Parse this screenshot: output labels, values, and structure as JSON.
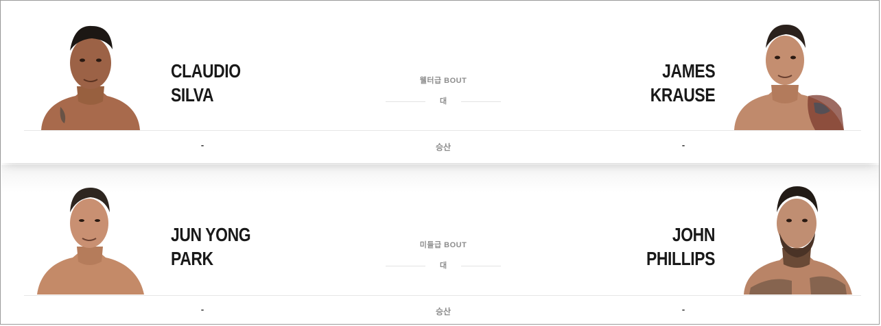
{
  "bouts": [
    {
      "red": {
        "first": "CLAUDIO",
        "last": "SILVA",
        "odds": "-"
      },
      "blue": {
        "first": "JAMES",
        "last": "KRAUSE",
        "odds": "-"
      },
      "weight_class": "웰터급 BOUT",
      "vs": "대",
      "result": "승산"
    },
    {
      "red": {
        "first": "JUN YONG",
        "last": "PARK",
        "odds": "-"
      },
      "blue": {
        "first": "JOHN",
        "last": "PHILLIPS",
        "odds": "-"
      },
      "weight_class": "미들급 BOUT",
      "vs": "대",
      "result": "승산"
    }
  ],
  "colors": {
    "name_text": "#191919",
    "muted_text": "#8d8d8d",
    "divider": "#e6e6e6",
    "skin": "#b07556",
    "hair": "#1c1714"
  }
}
